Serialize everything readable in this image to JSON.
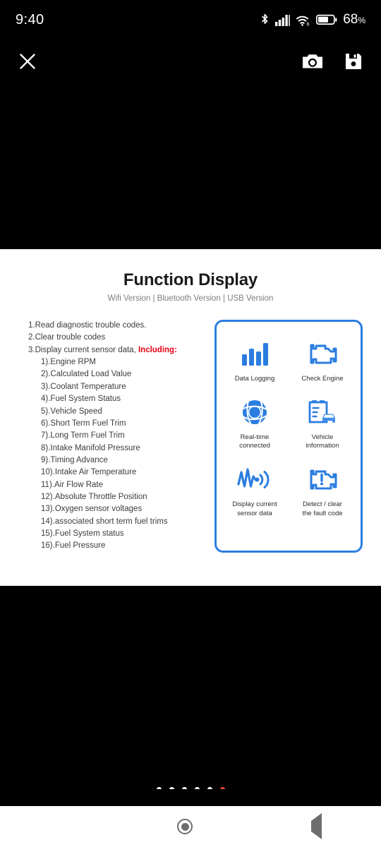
{
  "statusbar": {
    "time": "9:40",
    "battery_percent": "68",
    "percent_symbol": "%",
    "icons": [
      "bluetooth-icon",
      "cellular-signal-icon",
      "wifi-6-icon",
      "battery-icon"
    ]
  },
  "toolbar": {
    "close_label": "close-icon",
    "camera_label": "camera-icon",
    "save_label": "save-icon"
  },
  "photo": {
    "title": "Function Display",
    "subtitle": "Wifi Version | Bluetooth Version | USB Version",
    "features": [
      {
        "text": "1.Read diagnostic trouble codes.",
        "level": "main"
      },
      {
        "text": "2.Clear trouble codes",
        "level": "main"
      },
      {
        "text": "3.Display current sensor data, ",
        "level": "main",
        "emphasis": "Including:"
      },
      {
        "text": "1).Engine RPM",
        "level": "sub"
      },
      {
        "text": "2).Calculated Load Value",
        "level": "sub"
      },
      {
        "text": "3).Coolant Temperature",
        "level": "sub"
      },
      {
        "text": "4).Fuel System Status",
        "level": "sub"
      },
      {
        "text": "5).Vehicle Speed",
        "level": "sub"
      },
      {
        "text": "6).Short Term Fuel Trim",
        "level": "sub"
      },
      {
        "text": "7).Long Term Fuel Trim",
        "level": "sub"
      },
      {
        "text": "8).Intake Manifold Pressure",
        "level": "sub"
      },
      {
        "text": "9).Timing Advance",
        "level": "sub"
      },
      {
        "text": "10).Intake Air Temperature",
        "level": "sub"
      },
      {
        "text": "11).Air Flow Rate",
        "level": "sub"
      },
      {
        "text": "12).Absolute Throttle Position",
        "level": "sub"
      },
      {
        "text": "13).Oxygen sensor voltages",
        "level": "sub"
      },
      {
        "text": "14).associated short term fuel trims",
        "level": "sub"
      },
      {
        "text": "15).Fuel System status",
        "level": "sub"
      },
      {
        "text": "16).Fuel Pressure",
        "level": "sub"
      }
    ],
    "icon_panel": {
      "border_color": "#2b7de0",
      "items": [
        {
          "icon": "bar-chart-icon",
          "label": "Data Logging"
        },
        {
          "icon": "check-engine-icon",
          "label": "Check Engine"
        },
        {
          "icon": "globe-network-icon",
          "label": "Real-time\nconnected"
        },
        {
          "icon": "clipboard-car-icon",
          "label": "Vehicle\ninformation"
        },
        {
          "icon": "sensor-waveform-signal-icon",
          "label": "Display current\nsensor data"
        },
        {
          "icon": "engine-alert-icon",
          "label": "Detect / clear\nthe fault code"
        }
      ]
    }
  },
  "pager": {
    "total": 6,
    "active_index": 5,
    "active_color": "#e8453c",
    "inactive_color": "#ffffff"
  },
  "navbar": {
    "recents_label": "recents-button",
    "home_label": "home-button",
    "back_label": "back-button"
  }
}
